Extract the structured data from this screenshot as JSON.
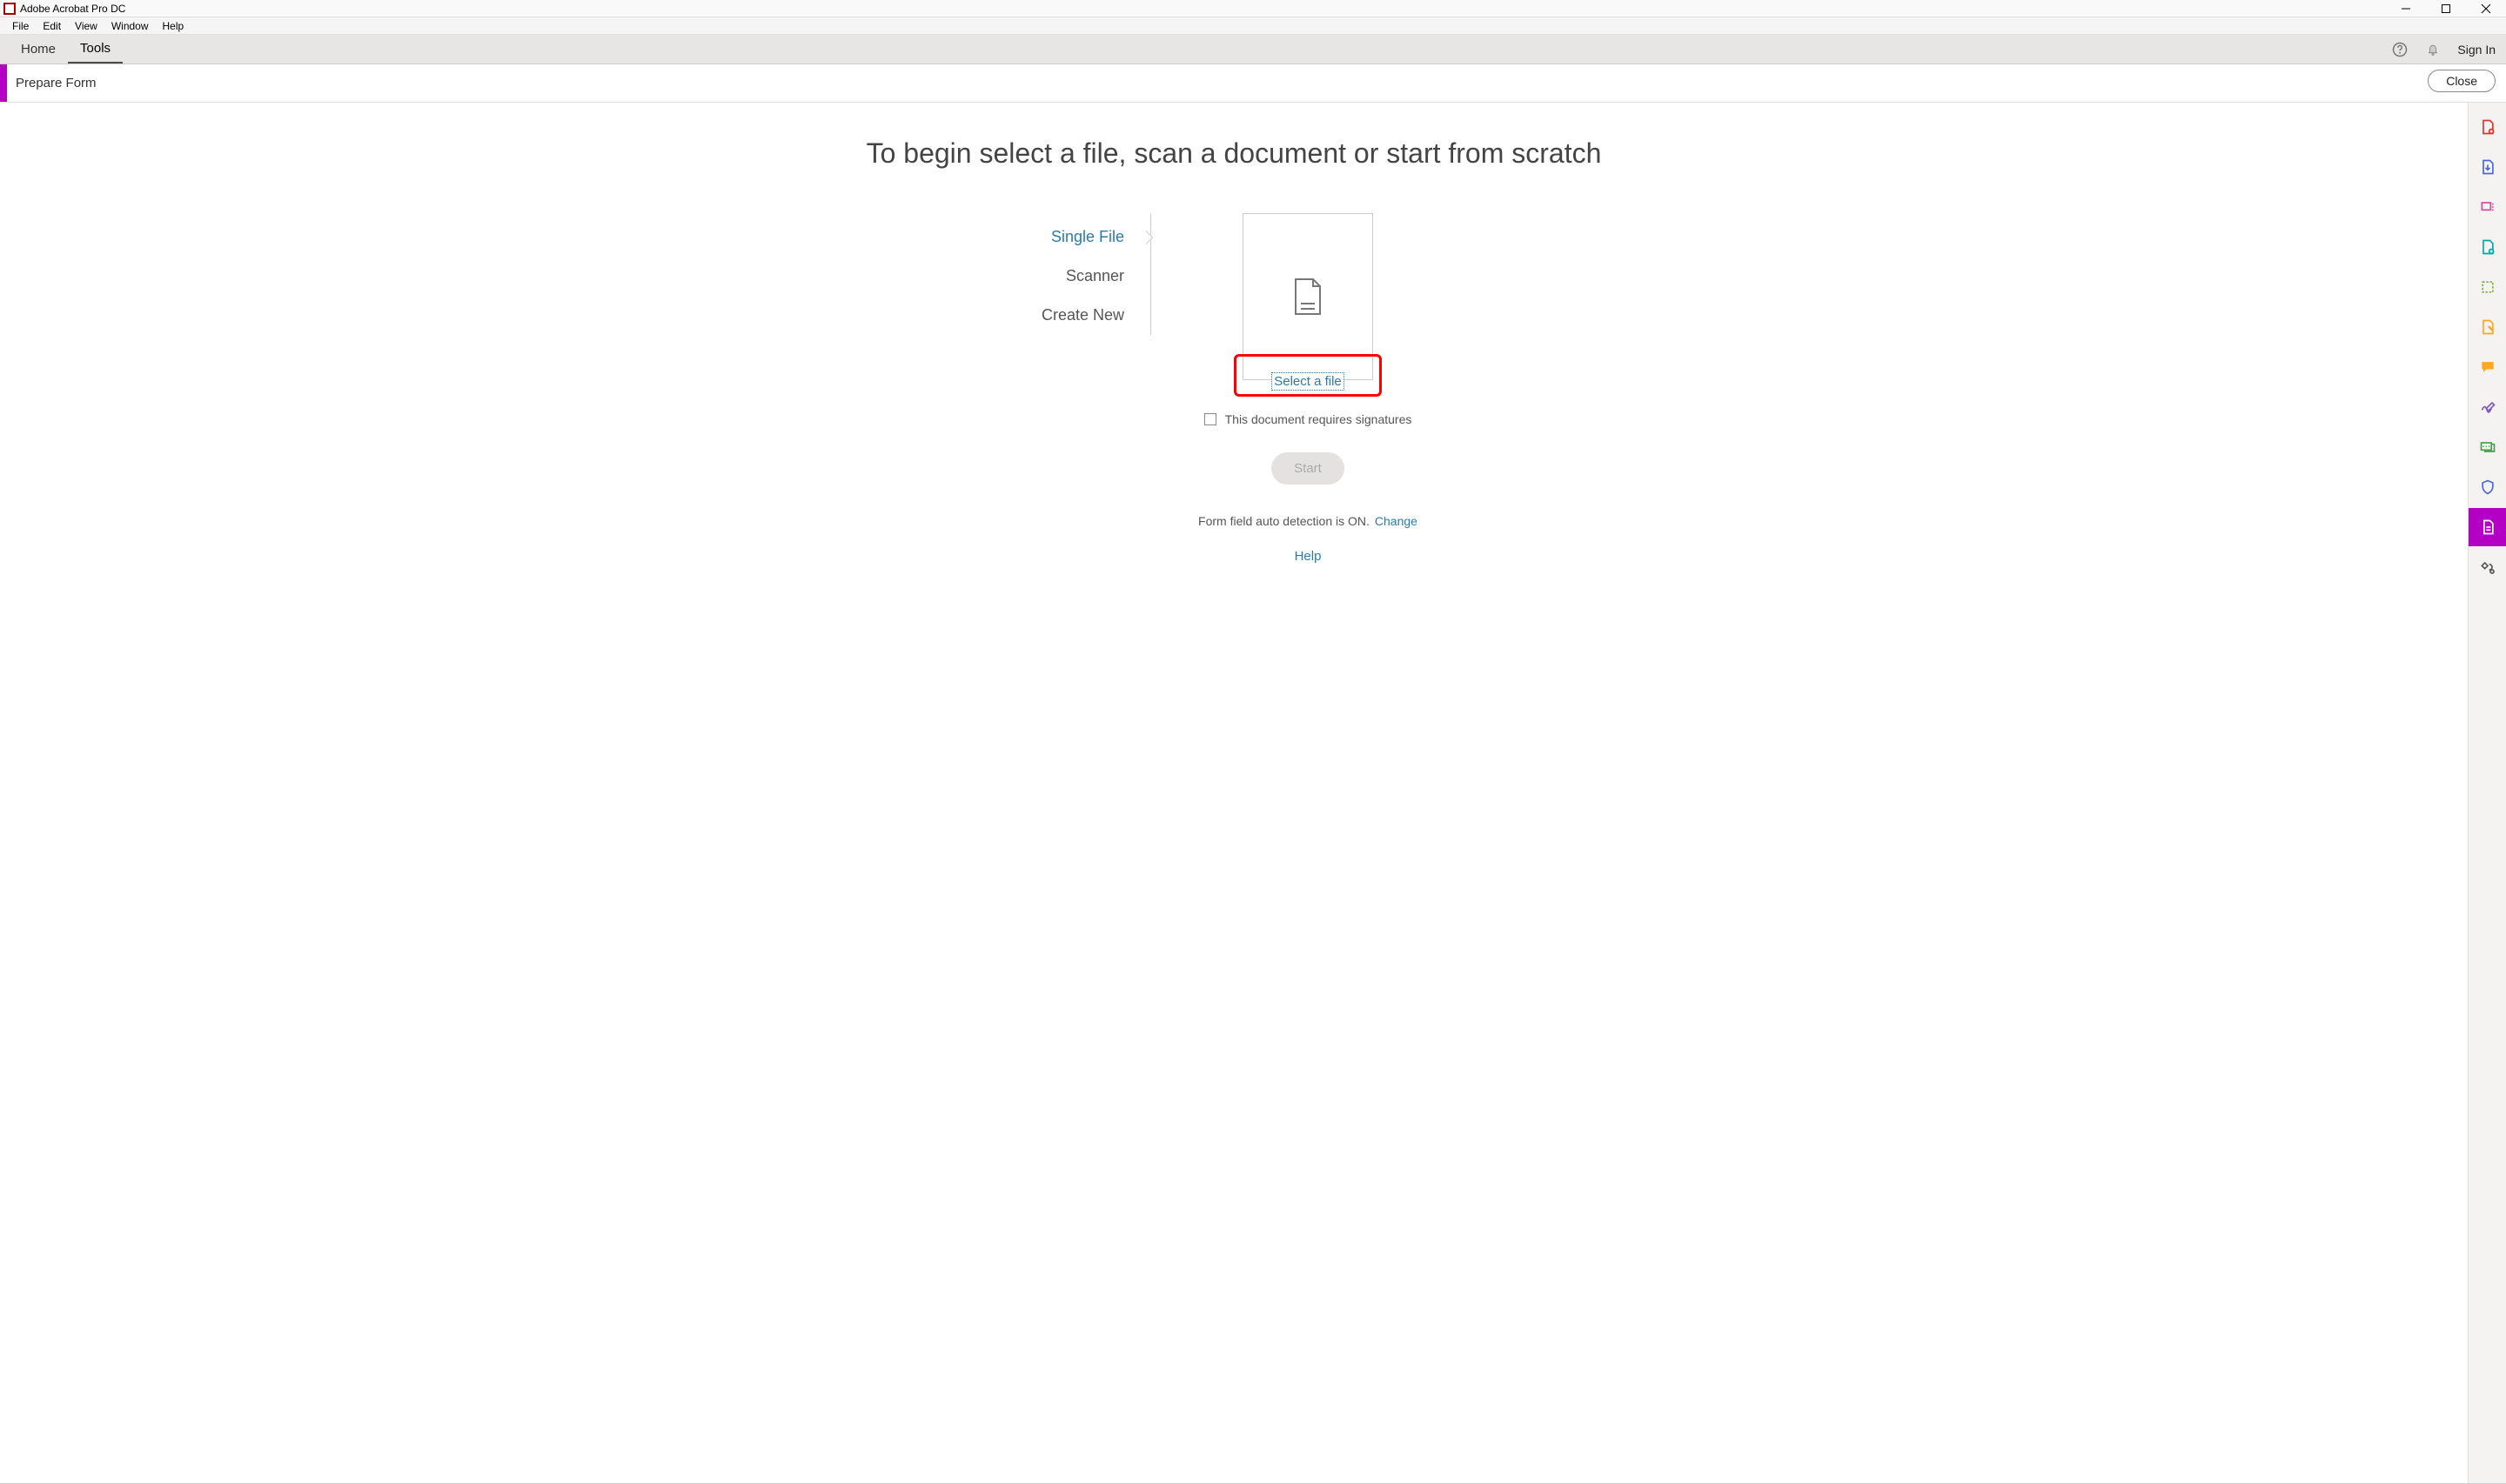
{
  "titlebar": {
    "title": "Adobe Acrobat Pro DC"
  },
  "menubar": {
    "items": [
      "File",
      "Edit",
      "View",
      "Window",
      "Help"
    ]
  },
  "navbar": {
    "items": [
      "Home",
      "Tools"
    ],
    "signin": "Sign In"
  },
  "tool_header": {
    "title": "Prepare Form",
    "close": "Close"
  },
  "main": {
    "heading": "To begin select a file, scan a document or start from scratch",
    "tabs": [
      "Single File",
      "Scanner",
      "Create New"
    ],
    "select_file": "Select a file",
    "checkbox_label": "This document requires signatures",
    "start": "Start",
    "auto_detect_text": "Form field auto detection is ON.",
    "change": "Change",
    "help": "Help"
  },
  "right_sidebar": {
    "tools": [
      "create-pdf-icon",
      "export-pdf-icon",
      "edit-pdf-icon",
      "combine-files-icon",
      "organize-pages-icon",
      "redact-icon",
      "comment-icon",
      "fill-sign-icon",
      "send-tracking-icon",
      "protect-icon",
      "prepare-form-icon",
      "more-tools-icon"
    ]
  }
}
